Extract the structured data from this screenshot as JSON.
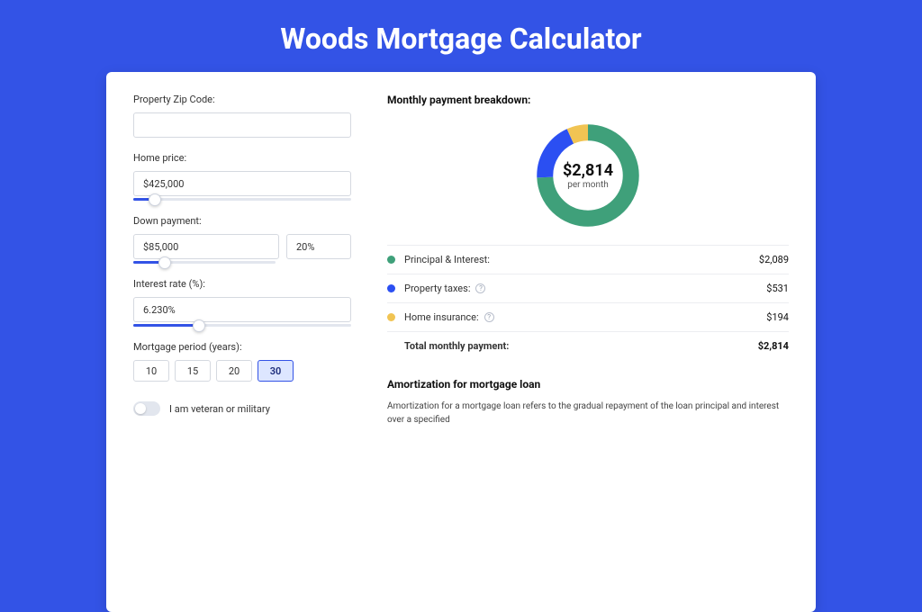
{
  "title": "Woods Mortgage Calculator",
  "form": {
    "zip": {
      "label": "Property Zip Code:",
      "value": ""
    },
    "home_price": {
      "label": "Home price:",
      "value": "$425,000",
      "slider_pct": 10
    },
    "down_payment": {
      "label": "Down payment:",
      "amount": "$85,000",
      "percent": "20%",
      "slider_pct": 22
    },
    "interest": {
      "label": "Interest rate (%):",
      "value": "6.230%",
      "slider_pct": 30
    },
    "period": {
      "label": "Mortgage period (years):",
      "options": [
        "10",
        "15",
        "20",
        "30"
      ],
      "active": "30"
    },
    "veteran": {
      "label": "I am veteran or military",
      "checked": false
    }
  },
  "breakdown": {
    "title": "Monthly payment breakdown:",
    "center_amount": "$2,814",
    "center_sub": "per month",
    "items": [
      {
        "label": "Principal & Interest:",
        "value": "$2,089",
        "color": "#3fa07a",
        "help": false
      },
      {
        "label": "Property taxes:",
        "value": "$531",
        "color": "#2b4ff2",
        "help": true
      },
      {
        "label": "Home insurance:",
        "value": "$194",
        "color": "#f1c453",
        "help": true
      }
    ],
    "total": {
      "label": "Total monthly payment:",
      "value": "$2,814"
    }
  },
  "amortization": {
    "title": "Amortization for mortgage loan",
    "body": "Amortization for a mortgage loan refers to the gradual repayment of the loan principal and interest over a specified"
  },
  "colors": {
    "green": "#3fa07a",
    "blue": "#2b4ff2",
    "yellow": "#f1c453"
  },
  "chart_data": {
    "type": "pie",
    "title": "Monthly payment breakdown",
    "series": [
      {
        "name": "Principal & Interest",
        "value": 2089,
        "color": "#3fa07a"
      },
      {
        "name": "Property taxes",
        "value": 531,
        "color": "#2b4ff2"
      },
      {
        "name": "Home insurance",
        "value": 194,
        "color": "#f1c453"
      }
    ],
    "total": 2814,
    "center_label": "$2,814 per month"
  }
}
